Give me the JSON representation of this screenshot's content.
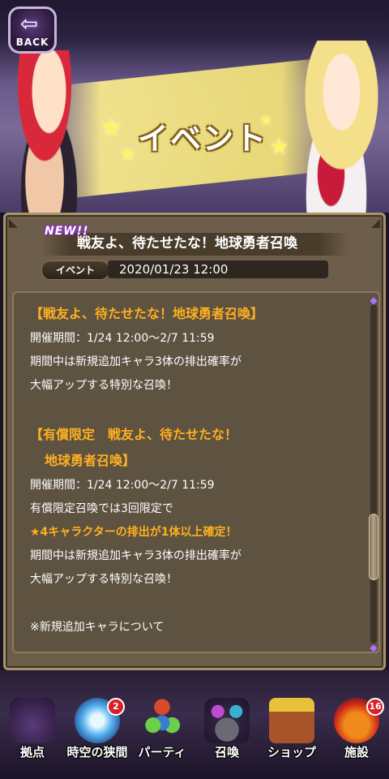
{
  "header": {
    "back_label": "BACK",
    "banner_title": "イベント"
  },
  "news": {
    "badge": "NEW!!",
    "title": "戦友よ、待たせたな！地球勇者召喚",
    "category": "イベント",
    "date": "2020/01/23 12:00"
  },
  "content": {
    "lines": [
      "【戦友よ、待たせたな！地球勇者召喚】",
      "開催期間：1/24 12:00〜2/7 11:59",
      "期間中は新規追加キャラ3体の排出確率が",
      "大幅アップする特別な召喚！",
      "【有償限定　戦友よ、待たせたな！",
      "地球勇者召喚】",
      "開催期間：1/24 12:00〜2/7 11:59",
      "有償限定召喚では3回限定で",
      "★4キャラクターの排出が1体以上確定！",
      "期間中は新規追加キャラ3体の排出確率が",
      "大幅アップする特別な召喚！",
      "※新規追加キャラについて"
    ]
  },
  "nav": {
    "items": [
      {
        "label": "拠点",
        "badge": ""
      },
      {
        "label": "時空の狭間",
        "badge": "2"
      },
      {
        "label": "パーティ",
        "badge": ""
      },
      {
        "label": "召喚",
        "badge": ""
      },
      {
        "label": "ショップ",
        "badge": ""
      },
      {
        "label": "施設",
        "badge": "16"
      }
    ]
  },
  "colors": {
    "accent": "#ffb020",
    "panel": "#6c5e4a",
    "badge": "#d8202a"
  }
}
